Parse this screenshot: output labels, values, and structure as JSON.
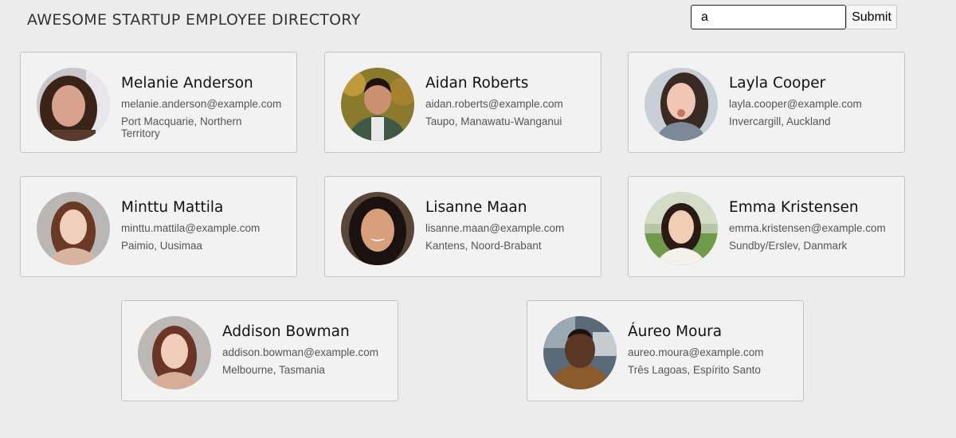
{
  "header": {
    "title": "AWESOME STARTUP EMPLOYEE DIRECTORY",
    "search_value": "a",
    "submit_label": "Submit"
  },
  "employees": [
    {
      "name": "Melanie Anderson",
      "email": "melanie.anderson@example.com",
      "location": "Port Macquarie, Northern Territory"
    },
    {
      "name": "Aidan Roberts",
      "email": "aidan.roberts@example.com",
      "location": "Taupo, Manawatu-Wanganui"
    },
    {
      "name": "Layla Cooper",
      "email": "layla.cooper@example.com",
      "location": "Invercargill, Auckland"
    },
    {
      "name": "Minttu Mattila",
      "email": "minttu.mattila@example.com",
      "location": "Paimio, Uusimaa"
    },
    {
      "name": "Lisanne Maan",
      "email": "lisanne.maan@example.com",
      "location": "Kantens, Noord-Brabant"
    },
    {
      "name": "Emma Kristensen",
      "email": "emma.kristensen@example.com",
      "location": "Sundby/Erslev, Danmark"
    },
    {
      "name": "Addison Bowman",
      "email": "addison.bowman@example.com",
      "location": "Melbourne, Tasmania"
    },
    {
      "name": "Áureo Moura",
      "email": "aureo.moura@example.com",
      "location": "Três Lagoas, Espírito Santo"
    }
  ]
}
